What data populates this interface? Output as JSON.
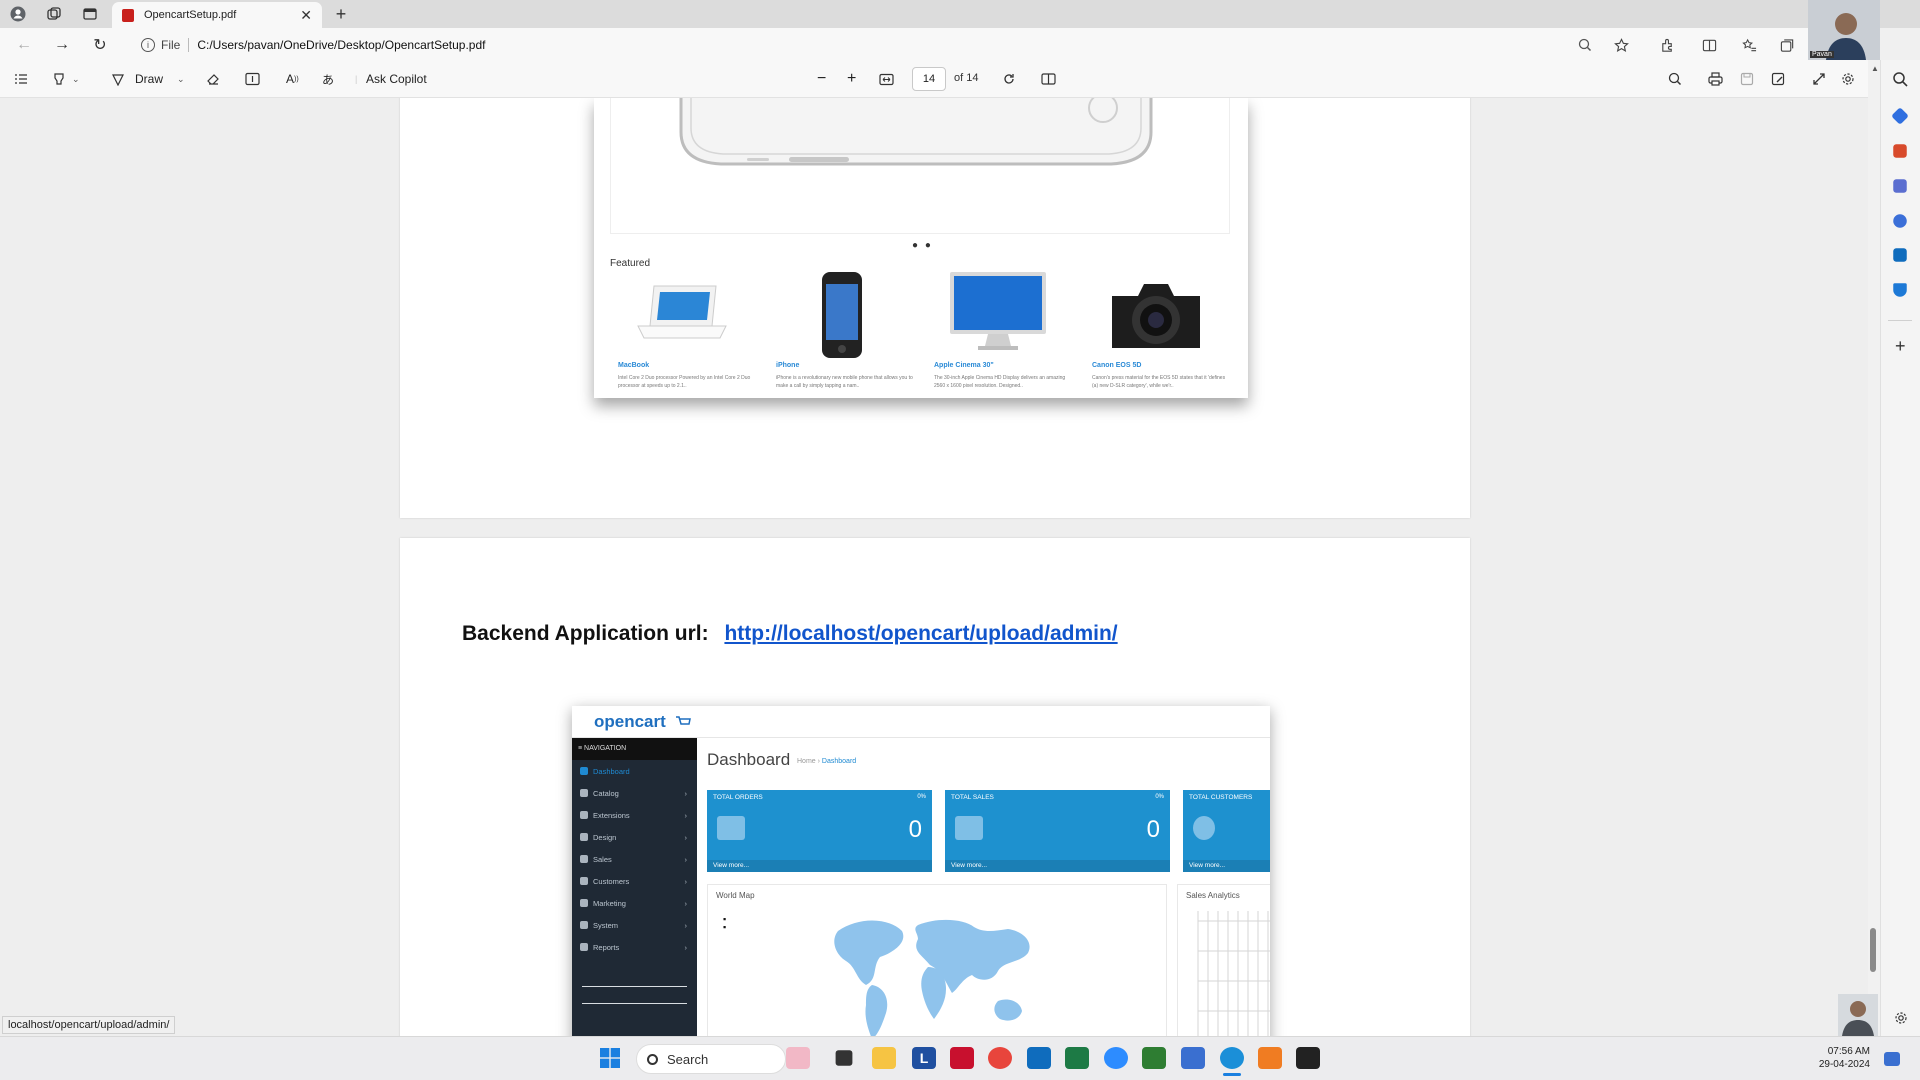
{
  "browser": {
    "tab_title": "OpencartSetup.pdf",
    "address_scheme_label": "File",
    "address_url": "C:/Users/pavan/OneDrive/Desktop/OpencartSetup.pdf",
    "webcam_name": "Pavan"
  },
  "pdf_toolbar": {
    "draw_label": "Draw",
    "ask_copilot_label": "Ask Copilot",
    "current_page": "14",
    "page_total_label": "of 14"
  },
  "page13": {
    "featured_label": "Featured",
    "carousel_dots": "● ●",
    "products": [
      {
        "name": "MacBook",
        "desc": "Intel Core 2 Duo processor Powered by an Intel Core 2 Duo processor at speeds up to 2.1.."
      },
      {
        "name": "iPhone",
        "desc": "iPhone is a revolutionary new mobile phone that allows you to make a call by simply tapping a nam.."
      },
      {
        "name": "Apple Cinema 30\"",
        "desc": "The 30-inch Apple Cinema HD Display delivers an amazing 2560 x 1600 pixel resolution. Designed.."
      },
      {
        "name": "Canon EOS 5D",
        "desc": "Canon's press material for the EOS 5D states that it 'defines (a) new D-SLR category', while we'r.."
      }
    ]
  },
  "page14": {
    "heading_label": "Backend Application url:",
    "heading_link": "http://localhost/opencart/upload/admin/",
    "admin": {
      "logo": "opencart",
      "nav_header": "≡ NAVIGATION",
      "nav_items": [
        "Dashboard",
        "Catalog",
        "Extensions",
        "Design",
        "Sales",
        "Customers",
        "Marketing",
        "System",
        "Reports"
      ],
      "title": "Dashboard",
      "breadcrumb_home": "Home",
      "breadcrumb_current": "Dashboard",
      "tiles": [
        {
          "title": "TOTAL ORDERS",
          "pct": "0%",
          "value": "0",
          "more": "View more..."
        },
        {
          "title": "TOTAL SALES",
          "pct": "0%",
          "value": "0",
          "more": "View more..."
        },
        {
          "title": "TOTAL CUSTOMERS",
          "pct": "",
          "value": "",
          "more": "View more..."
        }
      ],
      "world_map_label": "World Map",
      "sales_analytics_label": "Sales Analytics"
    }
  },
  "status_bar_url": "localhost/opencart/upload/admin/",
  "taskbar": {
    "search_label": "Search",
    "time": "07:56 AM",
    "date": "29-04-2024"
  }
}
